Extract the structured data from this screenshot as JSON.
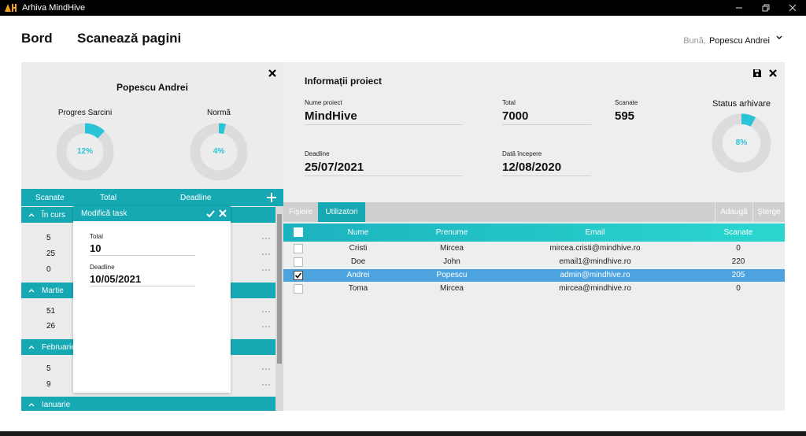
{
  "window": {
    "title": "Arhiva MindHive",
    "logo_text": "AH"
  },
  "nav": {
    "board": "Bord",
    "scan": "Scanează pagini"
  },
  "user": {
    "greeting": "Bună,",
    "name": "Popescu Andrei"
  },
  "left": {
    "name": "Popescu Andrei",
    "progress": {
      "label": "Progres Sarcini",
      "value": "12%",
      "fraction": 0.12
    },
    "norm": {
      "label": "Normă",
      "value": "4%",
      "fraction": 0.04
    },
    "list_headers": [
      "Scanate",
      "Total",
      "Deadline"
    ],
    "groups": [
      {
        "label": "În curs",
        "rows": [
          "5",
          "25",
          "0"
        ]
      },
      {
        "label": "Martie",
        "rows": [
          "51",
          "26"
        ]
      },
      {
        "label": "Februarie",
        "rows": [
          "5",
          "9"
        ]
      },
      {
        "label": "Ianuarie",
        "rows": []
      }
    ]
  },
  "popup": {
    "title": "Modifică task",
    "total_label": "Total",
    "total_value": "10",
    "deadline_label": "Deadline",
    "deadline_value": "10/05/2021"
  },
  "project": {
    "title": "Informații proiect",
    "name_label": "Nume proiect",
    "name_value": "MindHive",
    "total_label": "Total",
    "total_value": "7000",
    "scanned_label": "Scanate",
    "scanned_value": "595",
    "deadline_label": "Deadline",
    "deadline_value": "25/07/2021",
    "start_label": "Dată începere",
    "start_value": "12/08/2020",
    "status_label": "Status arhivare",
    "status_value": "8%",
    "status_fraction": 0.08
  },
  "tabs": {
    "files": "Fișiere",
    "users": "Utilizatori",
    "add": "Adaugă",
    "delete": "Șterge"
  },
  "table": {
    "headers": [
      "Nume",
      "Prenume",
      "Email",
      "Scanate"
    ],
    "rows": [
      {
        "nume": "Cristi",
        "prenume": "Mircea",
        "email": "mircea.cristi@mindhive.ro",
        "scanate": "0",
        "checked": false
      },
      {
        "nume": "Doe",
        "prenume": "John",
        "email": "email1@mindhive.ro",
        "scanate": "220",
        "checked": false
      },
      {
        "nume": "Andrei",
        "prenume": "Popescu",
        "email": "admin@mindhive.ro",
        "scanate": "205",
        "checked": true
      },
      {
        "nume": "Toma",
        "prenume": "Mircea",
        "email": "mircea@mindhive.ro",
        "scanate": "0",
        "checked": false
      }
    ]
  },
  "colors": {
    "accent": "#17a9b3",
    "accent_light": "#2bc3d6",
    "selected_row": "#4da3dd"
  }
}
